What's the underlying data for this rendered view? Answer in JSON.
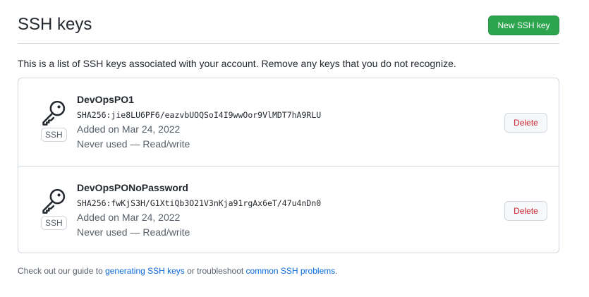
{
  "header": {
    "title": "SSH keys",
    "new_button_label": "New SSH key"
  },
  "intro": "This is a list of SSH keys associated with your account. Remove any keys that you do not recognize.",
  "keys": [
    {
      "title": "DevOpsPO1",
      "fingerprint": "SHA256:jie8LU6PF6/eazvbUOQSoI4I9wwOor9VlMDT7hA9RLU",
      "added": "Added on Mar 24, 2022",
      "usage": "Never used — Read/write",
      "label": "SSH",
      "delete_label": "Delete",
      "icon": "key-icon"
    },
    {
      "title": "DevOpsPONoPassword",
      "fingerprint": "SHA256:fwKjS3H/G1XtiQb3O21V3nKja91rgAx6eT/47u4nDn0",
      "added": "Added on Mar 24, 2022",
      "usage": "Never used — Read/write",
      "label": "SSH",
      "delete_label": "Delete",
      "icon": "key-icon"
    }
  ],
  "footer": {
    "prefix": "Check out our guide to ",
    "link1": "generating SSH keys",
    "middle": " or troubleshoot ",
    "link2": "common SSH problems",
    "suffix": "."
  },
  "colors": {
    "primary_button": "#2da44e",
    "danger_text": "#cf222e",
    "link": "#0969da",
    "border": "#d0d7de"
  }
}
